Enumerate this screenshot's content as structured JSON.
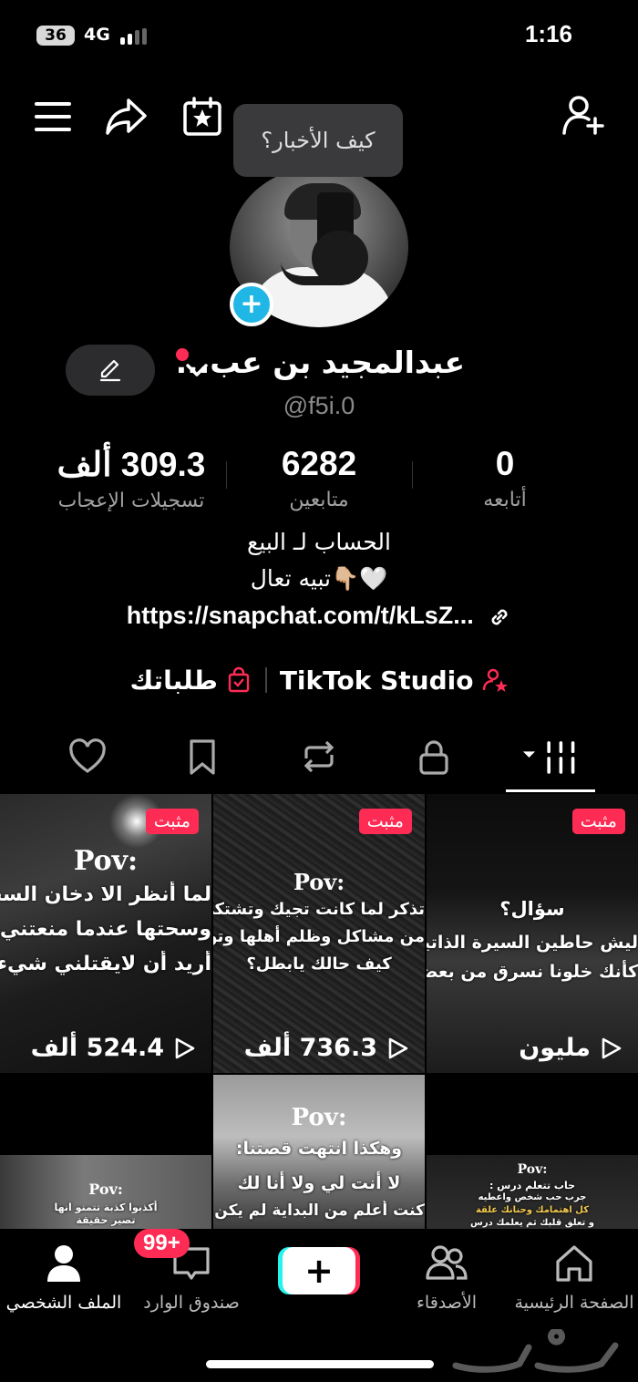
{
  "status_bar": {
    "battery": "36",
    "network": "4G",
    "time": "1:16"
  },
  "header": {
    "tooltip": "كيف الأخبار؟"
  },
  "profile": {
    "display_name": "عبدالمجيد بن عب...",
    "username": "@f5i.0"
  },
  "stats": [
    {
      "value": "309.3 ألف",
      "label": "تسجيلات الإعجاب"
    },
    {
      "value": "6282",
      "label": "متابعين"
    },
    {
      "value": "0",
      "label": "أتابعه"
    }
  ],
  "bio": {
    "line1": "الحساب لـ البيع",
    "line2": "تبيه تعال👇🏼🤍",
    "link": "https://snapchat.com/t/kLsZ..."
  },
  "actions": {
    "studio": "TikTok Studio",
    "orders": "طلباتك"
  },
  "videos": [
    {
      "pinned": "مثبت",
      "views": "524.4 ألف",
      "pov": "Pov:",
      "lines": [
        "لما أنظر الا دخان السجا",
        "وسحتها عندما منعتني ع",
        "أريد أن لايقتلني شيء"
      ]
    },
    {
      "pinned": "مثبت",
      "views": "736.3 ألف",
      "pov": "Pov:",
      "lines": [
        "تذكر لما كانت تجيك وتشتكي",
        "من مشاكل وظلم أهلها وتواسيها",
        "كيف حالك يابطل؟"
      ]
    },
    {
      "pinned": "مثبت",
      "views": "مليون",
      "pov": "",
      "lines": [
        "سؤال؟",
        "ليش حاطين السيرة الذاتيه",
        "كأنك خلونا نسرق من بعض"
      ]
    },
    {
      "pov": "Pov:",
      "lines": [
        "أكذبوا كذبة تتمنو انها",
        "تصير حقيقة"
      ]
    },
    {
      "pov": "Pov:",
      "lines": [
        "وهكذا انتهت قصتنا:",
        "لا أنت لي ولا أنا لك",
        "كنت أعلم من البداية لم يكن لي"
      ]
    },
    {
      "pov": "Pov:",
      "lines": [
        "حاب تتعلم درس :",
        "جرب حب شخص واعطيه",
        "كل اهتمامك وحنانك علقة",
        "و تعلق قلبك ثم يعلمك درس"
      ]
    }
  ],
  "nav": {
    "profile": "الملف الشخصي",
    "inbox": "صندوق الوارد",
    "inbox_badge": "99+",
    "friends": "الأصدقاء",
    "home": "الصفحة الرئيسية"
  },
  "colors": {
    "accent": "#fe2c55",
    "cyan": "#25f4ee",
    "blue": "#20b6e6"
  },
  "icons": [
    "menu-icon",
    "share-icon",
    "calendar-star-icon",
    "add-user-icon",
    "edit-icon",
    "link-icon",
    "heart-icon",
    "bookmark-icon",
    "repost-icon",
    "lock-icon",
    "grid-icon",
    "play-icon",
    "home-icon",
    "friends-icon",
    "inbox-icon",
    "profile-icon"
  ]
}
